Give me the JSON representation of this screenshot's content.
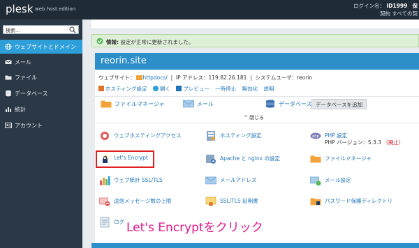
{
  "header": {
    "logo": "plesk",
    "edition": "web host edition",
    "login_label": "ログイン名：",
    "login_value": "ID1999",
    "login_tail": "保",
    "contract_line": "契約   すべての契"
  },
  "sidebar": {
    "search_placeholder": "検索...",
    "items": [
      {
        "label": "ウェブサイトとドメイン",
        "icon": "globe-icon",
        "active": true
      },
      {
        "label": "メール",
        "icon": "envelope-icon",
        "active": false
      },
      {
        "label": "ファイル",
        "icon": "folder-icon",
        "active": false
      },
      {
        "label": "データベース",
        "icon": "database-icon",
        "active": false
      },
      {
        "label": "統計",
        "icon": "bar-chart-icon",
        "active": false
      },
      {
        "label": "アカウント",
        "icon": "account-icon",
        "active": false
      }
    ]
  },
  "notice": {
    "label": "情報:",
    "text": "設定が正常に更新されました。"
  },
  "domain": {
    "name": "reorin.site",
    "website_label": "ウェブサイト：",
    "website_path": "httpdocs/",
    "ip_label": "IP アドレス：",
    "ip_value": "119.82.26.181",
    "sysuser_label": "システムユーザ：",
    "sysuser_value": "reorin",
    "links": [
      "ホスティング設定",
      "開く",
      "プレビュー",
      "一時停止",
      "無効化",
      "説明"
    ]
  },
  "quick": {
    "file_manager": "ファイルマネージャ",
    "mail": "メール",
    "databases": "データベース",
    "add_database": "データベースを追加",
    "collapse": "^ 閉じる"
  },
  "tools": [
    {
      "label": "ウェブホスティングアクセス",
      "icon": "hosting-access-icon"
    },
    {
      "label": "ホスティング設定",
      "icon": "hosting-settings-icon"
    },
    {
      "label": "PHP 設定",
      "icon": "php-icon",
      "sub_label": "PHP バージョン：5.3.3",
      "sub_note": "（廃止）"
    },
    {
      "label": "Let's Encrypt",
      "icon": "lets-encrypt-icon"
    },
    {
      "label": "Apache と nginx の設定",
      "icon": "apache-nginx-icon"
    },
    {
      "label": "ファイルマネージャ",
      "icon": "folder-icon"
    },
    {
      "label": "ウェブ統計 SSL/TLS",
      "icon": "web-stats-icon"
    },
    {
      "label": "メールアドレス",
      "icon": "mail-address-icon"
    },
    {
      "label": "メール設定",
      "icon": "mail-settings-icon"
    },
    {
      "label": "送信メッセージ数の上限",
      "icon": "outgoing-limit-icon"
    },
    {
      "label": "SSL/TLS 証明書",
      "icon": "certificate-icon"
    },
    {
      "label": "パスワード保護ディレクトリ",
      "icon": "password-dir-icon"
    },
    {
      "label": "ログ",
      "icon": "logs-icon"
    }
  ],
  "annotation": {
    "caption": "Let's Encryptをクリック"
  },
  "colors": {
    "topbar": "#1f2b37",
    "sidebar": "#2b3946",
    "active": "#2e9fd8",
    "domain_header": "#2c8fc9",
    "link": "#1f73b7",
    "highlight": "#e02020",
    "caption": "#e0198a"
  }
}
